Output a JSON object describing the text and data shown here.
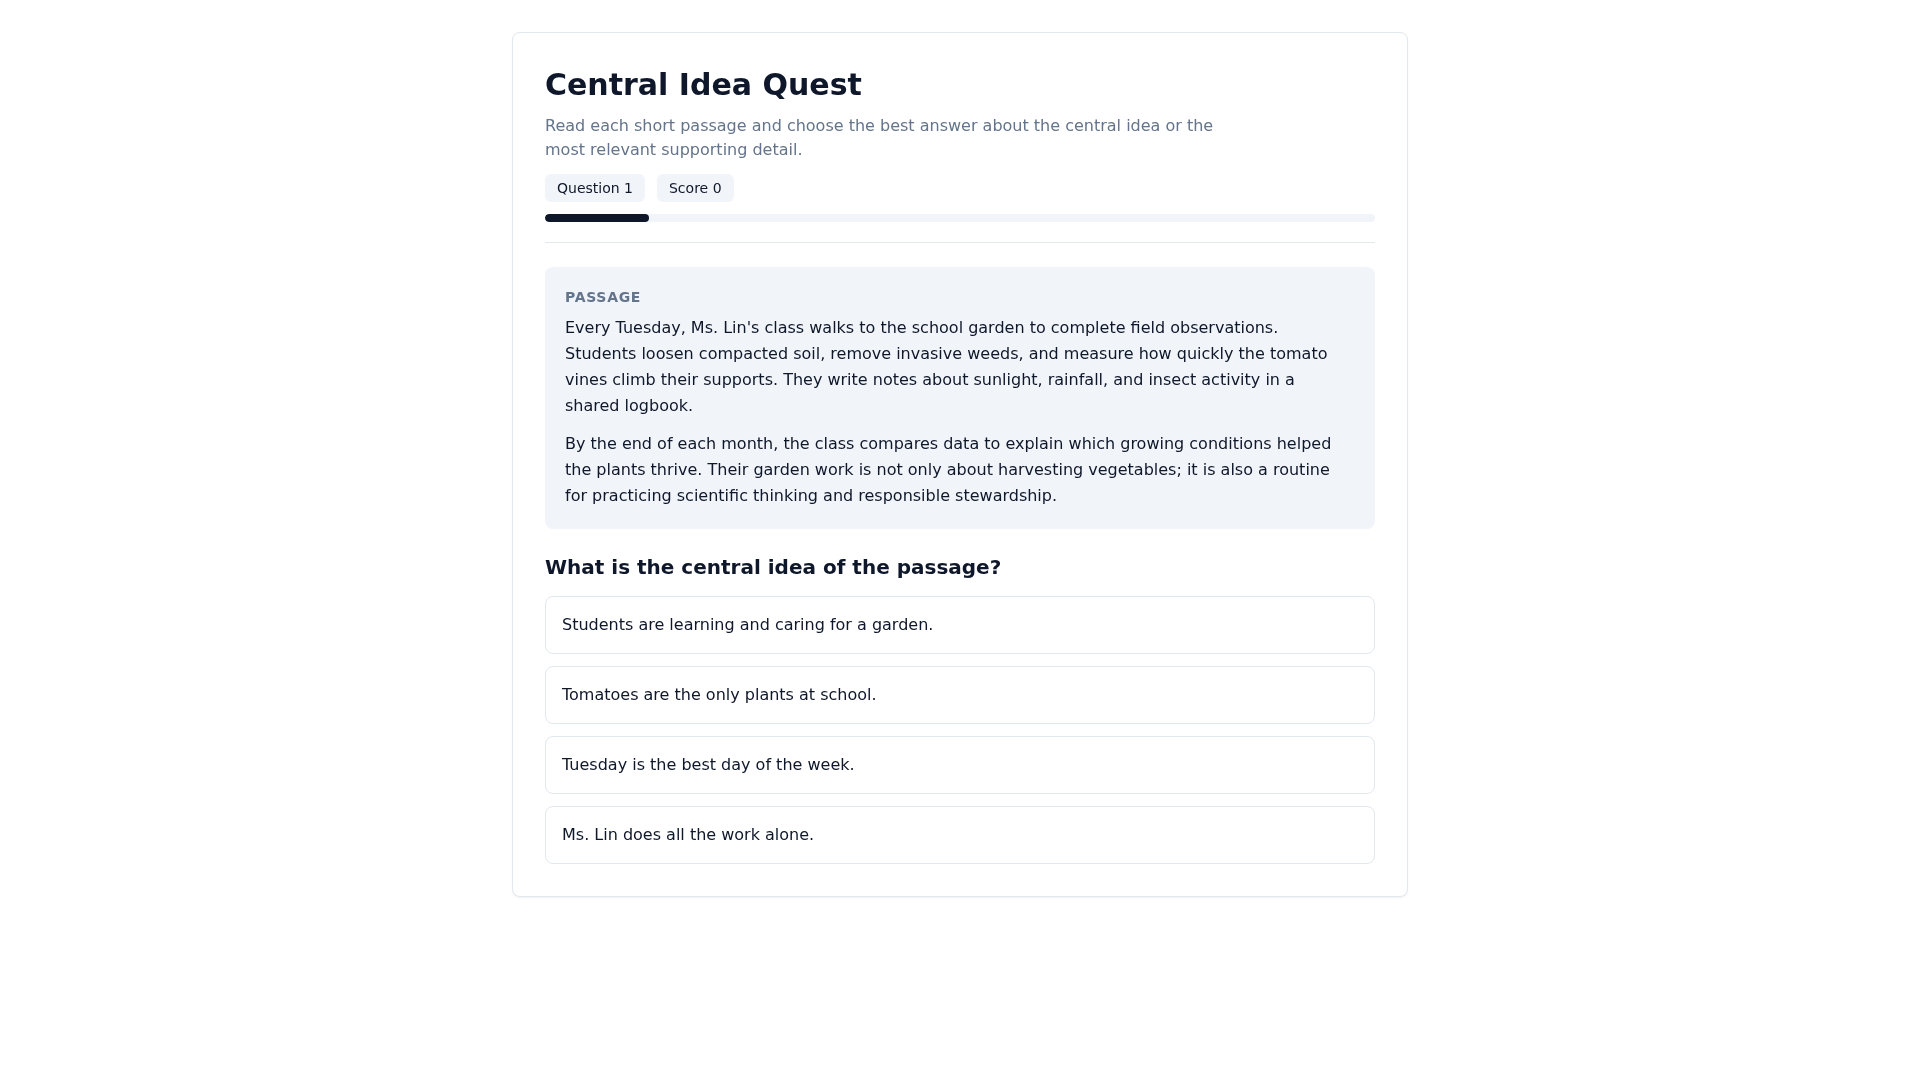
{
  "header": {
    "title": "Central Idea Quest",
    "description": "Read each short passage and choose the best answer about the central idea or the most relevant supporting detail.",
    "question_counter": "Question 1",
    "score_counter": "Score 0",
    "progress": {
      "level": 0.125
    }
  },
  "passage": {
    "label": "PASSAGE",
    "paragraphs": [
      "Every Tuesday, Ms. Lin's class walks to the school garden to complete field observations. Students loosen compacted soil, remove invasive weeds, and measure how quickly the tomato vines climb their supports. They write notes about sunlight, rainfall, and insect activity in a shared logbook.",
      "By the end of each month, the class compares data to explain which growing conditions helped the plants thrive. Their garden work is not only about harvesting vegetables; it is also a routine for practicing scientific thinking and responsible stewardship."
    ]
  },
  "question": {
    "prompt": "What is the central idea of the passage?",
    "options": [
      {
        "text": "Students are learning and caring for a garden.",
        "selected": false
      },
      {
        "text": "Tomatoes are the only plants at school.",
        "selected": false
      },
      {
        "text": "Tuesday is the best day of the week.",
        "selected": false
      },
      {
        "text": "Ms. Lin does all the work alone.",
        "selected": false
      }
    ]
  }
}
